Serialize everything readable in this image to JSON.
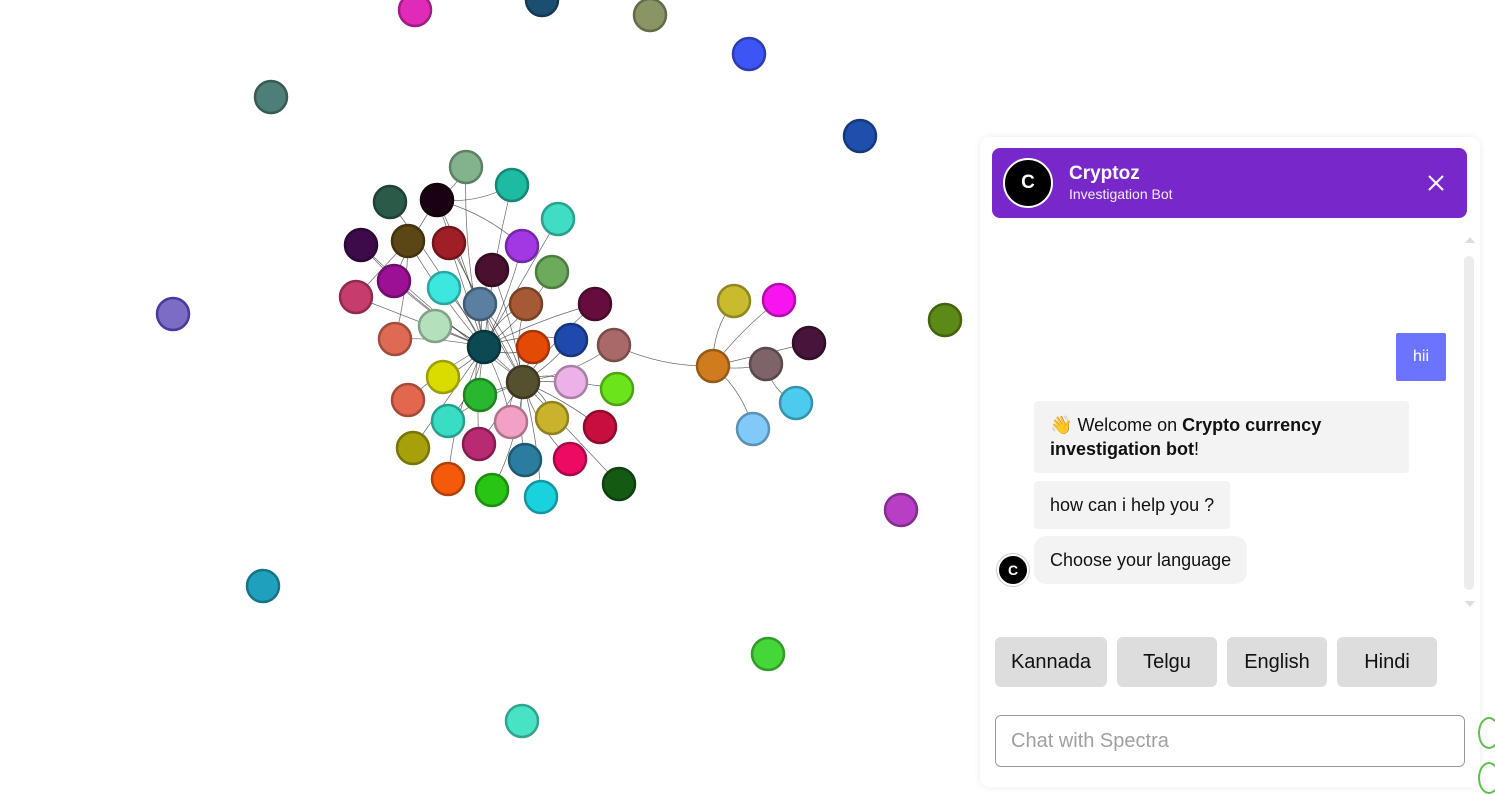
{
  "colors": {
    "header_bg": "#7827c9",
    "user_bubble_bg": "#6b73ff",
    "edge_icon_color": "#5cc24d"
  },
  "graph": {
    "nodes": [
      [
        "#e02ab8",
        415,
        10
      ],
      [
        "#1a4f72",
        542,
        0
      ],
      [
        "#8a9565",
        650,
        15
      ],
      [
        "#3d55f5",
        749,
        54
      ],
      [
        "#4e7e78",
        271,
        97
      ],
      [
        "#1f4fad",
        860,
        136
      ],
      [
        "#7c6cc4",
        173,
        314,
        "#4a3aa0"
      ],
      [
        "#5b8a16",
        945,
        320
      ],
      [
        "#b63fc6",
        901,
        510
      ],
      [
        "#1fa0bd",
        263,
        586
      ],
      [
        "#45d73a",
        768,
        654
      ],
      [
        "#47e3c4",
        522,
        721
      ],
      [
        "#82b38d",
        466,
        167
      ],
      [
        "#1dbba2",
        512,
        185
      ],
      [
        "#3eddc4",
        558,
        219
      ],
      [
        "#2c5a48",
        390,
        202
      ],
      [
        "#1a0212",
        437,
        200
      ],
      [
        "#3d0b4a",
        361,
        245
      ],
      [
        "#5b4716",
        408,
        241
      ],
      [
        "#a01f26",
        449,
        243
      ],
      [
        "#a238e4",
        522,
        246
      ],
      [
        "#6cab5c",
        552,
        272
      ],
      [
        "#49102f",
        492,
        270
      ],
      [
        "#9b1095",
        394,
        281
      ],
      [
        "#c63c6c",
        356,
        297
      ],
      [
        "#3de6df",
        444,
        288
      ],
      [
        "#5a7fa0",
        480,
        304
      ],
      [
        "#a55a35",
        526,
        304
      ],
      [
        "#650e3d",
        595,
        304
      ],
      [
        "#b4e0bc",
        435,
        326
      ],
      [
        "#df6a54",
        395,
        339
      ],
      [
        "#0b4a53",
        484,
        347
      ],
      [
        "#e24a05",
        533,
        347
      ],
      [
        "#1f49ad",
        571,
        340
      ],
      [
        "#a96969",
        614,
        345
      ],
      [
        "#dadc00",
        443,
        377
      ],
      [
        "#555030",
        523,
        382
      ],
      [
        "#ecb1e6",
        571,
        382
      ],
      [
        "#6be41b",
        617,
        389
      ],
      [
        "#e2674e",
        408,
        400
      ],
      [
        "#2ab730",
        480,
        395
      ],
      [
        "#38ddc4",
        448,
        421
      ],
      [
        "#f2a1c5",
        511,
        422
      ],
      [
        "#c9b32c",
        552,
        418
      ],
      [
        "#c80e3e",
        600,
        427
      ],
      [
        "#a7a109",
        413,
        448
      ],
      [
        "#b82a71",
        479,
        444
      ],
      [
        "#2b7c9e",
        525,
        460
      ],
      [
        "#ec0a62",
        570,
        459
      ],
      [
        "#f55a0b",
        448,
        479
      ],
      [
        "#28c514",
        492,
        490
      ],
      [
        "#1ad1de",
        541,
        497
      ],
      [
        "#145a13",
        619,
        484
      ],
      [
        "#c8bb2d",
        734,
        301
      ],
      [
        "#f714f1",
        779,
        300
      ],
      [
        "#47143b",
        809,
        343
      ],
      [
        "#d07c1e",
        713,
        366
      ],
      [
        "#7d6469",
        766,
        364
      ],
      [
        "#4dcbef",
        796,
        403
      ],
      [
        "#80c9f8",
        753,
        429
      ]
    ],
    "hub_edges": [
      [
        31,
        12
      ],
      [
        31,
        13
      ],
      [
        31,
        14
      ],
      [
        31,
        15
      ],
      [
        31,
        16
      ],
      [
        31,
        17
      ],
      [
        31,
        18
      ],
      [
        31,
        19
      ],
      [
        31,
        20
      ],
      [
        31,
        21
      ],
      [
        31,
        22
      ],
      [
        31,
        23
      ],
      [
        31,
        24
      ],
      [
        31,
        25
      ],
      [
        31,
        26
      ],
      [
        31,
        27
      ],
      [
        31,
        28
      ],
      [
        31,
        29
      ],
      [
        31,
        30
      ],
      [
        31,
        32
      ],
      [
        31,
        33
      ],
      [
        31,
        35
      ],
      [
        31,
        36
      ],
      [
        31,
        39
      ],
      [
        31,
        40
      ],
      [
        31,
        41
      ],
      [
        31,
        42
      ],
      [
        31,
        45
      ],
      [
        31,
        46
      ],
      [
        31,
        49
      ],
      [
        36,
        16
      ],
      [
        36,
        17
      ],
      [
        36,
        19
      ],
      [
        36,
        22
      ],
      [
        36,
        26
      ],
      [
        36,
        27
      ],
      [
        36,
        28
      ],
      [
        36,
        32
      ],
      [
        36,
        33
      ],
      [
        36,
        34
      ],
      [
        36,
        37
      ],
      [
        36,
        38
      ],
      [
        36,
        40
      ],
      [
        36,
        41
      ],
      [
        36,
        42
      ],
      [
        36,
        43
      ],
      [
        36,
        44
      ],
      [
        36,
        46
      ],
      [
        36,
        47
      ],
      [
        36,
        48
      ],
      [
        36,
        50
      ],
      [
        36,
        51
      ],
      [
        36,
        52
      ],
      [
        16,
        12
      ],
      [
        16,
        13
      ],
      [
        16,
        20
      ],
      [
        18,
        30
      ],
      [
        18,
        24
      ],
      [
        16,
        23
      ],
      [
        34,
        56
      ],
      [
        56,
        53
      ],
      [
        56,
        54
      ],
      [
        56,
        55
      ],
      [
        56,
        57
      ],
      [
        57,
        58
      ],
      [
        56,
        59
      ]
    ]
  },
  "chat": {
    "header": {
      "avatar_letter": "C",
      "title": "Cryptoz",
      "subtitle": "Investigation Bot"
    },
    "messages": {
      "user": "hii",
      "welcome_emoji": "👋",
      "welcome_prefix": "Welcome on ",
      "welcome_bold": "Crypto currency investigation bot",
      "welcome_suffix": "!",
      "help": "how can i help you ?",
      "language_prompt": "Choose your language",
      "bot_avatar_letter": "C"
    },
    "language_options": [
      "Kannada",
      "Telgu",
      "English",
      "Hindi"
    ],
    "input": {
      "placeholder": "Chat with Spectra",
      "value": ""
    }
  }
}
